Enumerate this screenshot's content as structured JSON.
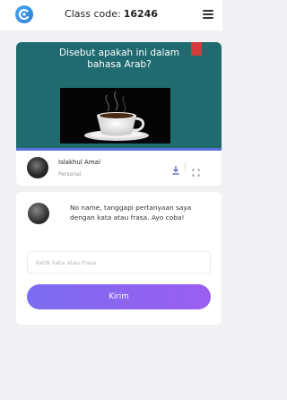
{
  "header": {
    "logo_icon": "app-logo-icon",
    "class_code_label": "Class code:",
    "class_code": "16246",
    "menu_icon": "hamburger-menu-icon"
  },
  "slide": {
    "question": "Disebut apakah ini dalam bahasa Arab?",
    "image": "coffee-cup-photo",
    "background_color": "#1f6b70"
  },
  "author": {
    "name": "Islakhul Amal",
    "role": "Personal",
    "download_icon": "download-icon",
    "fullscreen_icon": "fullscreen-icon"
  },
  "response": {
    "prompt": "No name, tanggapi pertanyaan saya dengan kata atau frasa. Ayo coba!",
    "input_placeholder": "Ketik kata atau frasa",
    "input_value": "",
    "submit_label": "Kirim",
    "accent_color": "#8b65f0"
  }
}
